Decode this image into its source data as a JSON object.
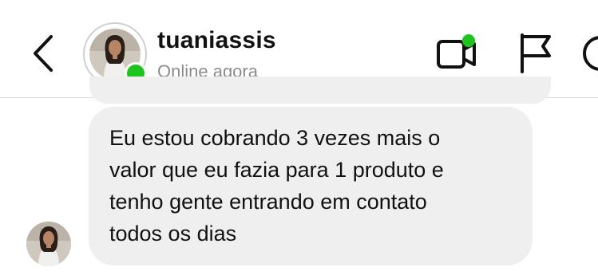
{
  "header": {
    "back_icon": "chevron-left-icon",
    "username": "tuaniassis",
    "status": "Online agora",
    "status_color": "#1ec41e",
    "actions": [
      "video-call-icon",
      "flag-icon",
      "info-icon"
    ]
  },
  "messages": [
    {
      "text": "Eu estou cobrando 3 vezes mais o valor que eu fazia para 1 produto e tenho gente entrando em contato todos os dias",
      "lines": [
        "Eu estou cobrando 3 vezes mais o",
        "valor que eu fazia para 1 produto e",
        "tenho gente entrando em contato",
        "todos os dias"
      ],
      "bubble_color": "#efefef"
    }
  ]
}
